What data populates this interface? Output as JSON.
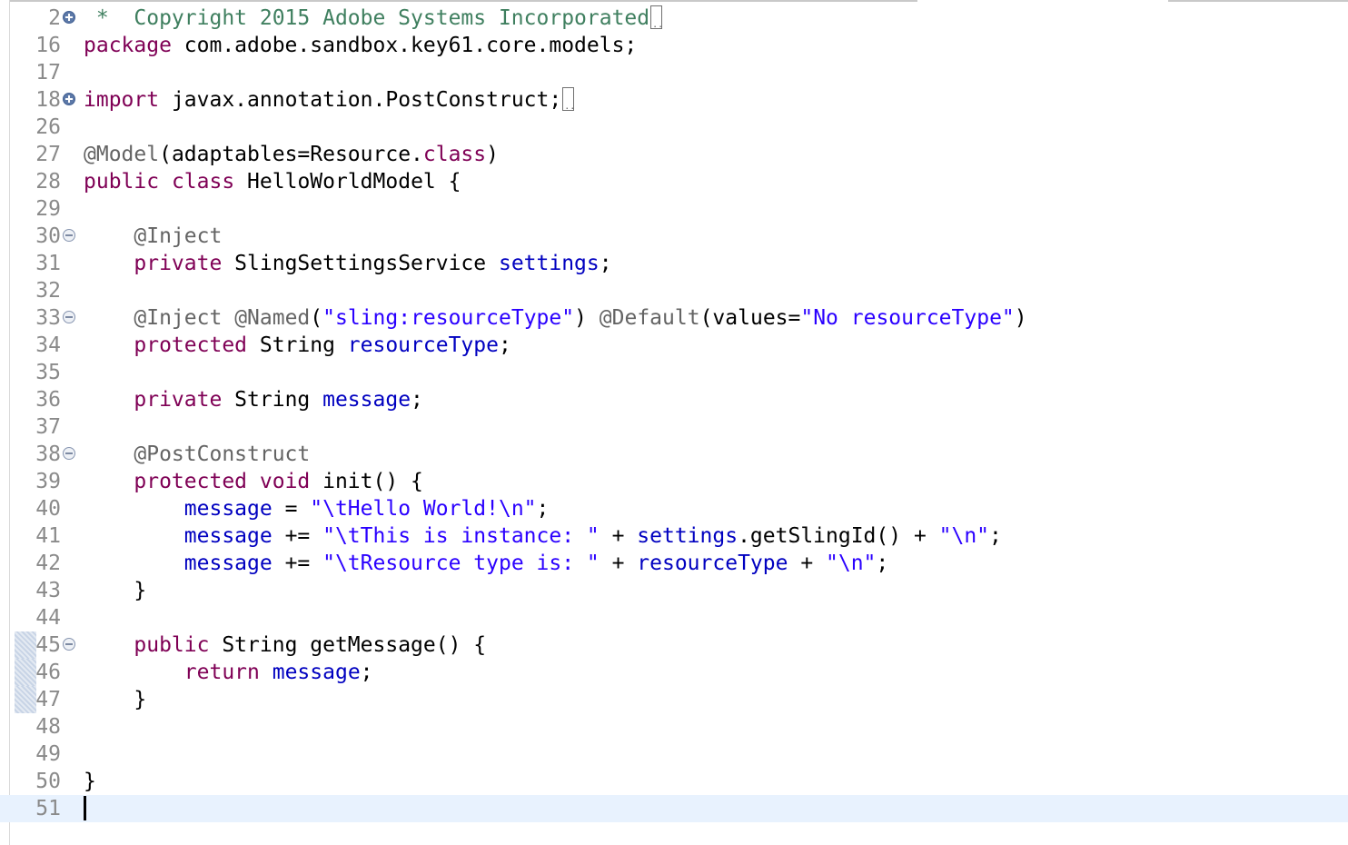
{
  "editor": {
    "lines": [
      {
        "n": "2",
        "fold": "plus",
        "tokens": [
          {
            "t": " *  ",
            "c": "cmt"
          },
          {
            "t": "Copyright 2015 Adobe Systems Incorporated",
            "c": "cmt"
          },
          {
            "t": "",
            "c": "ellipsis"
          }
        ]
      },
      {
        "n": "16",
        "tokens": [
          {
            "t": "package",
            "c": "kw"
          },
          {
            "t": " com.adobe.sandbox.key61.core.models;"
          }
        ]
      },
      {
        "n": "17",
        "tokens": []
      },
      {
        "n": "18",
        "fold": "plus",
        "tokens": [
          {
            "t": "import",
            "c": "kw"
          },
          {
            "t": " javax.annotation.PostConstruct;"
          },
          {
            "t": "",
            "c": "ellipsis"
          }
        ]
      },
      {
        "n": "26",
        "tokens": []
      },
      {
        "n": "27",
        "tokens": [
          {
            "t": "@Model",
            "c": "ann"
          },
          {
            "t": "(adaptables=Resource."
          },
          {
            "t": "class",
            "c": "kw"
          },
          {
            "t": ")"
          }
        ]
      },
      {
        "n": "28",
        "tokens": [
          {
            "t": "public",
            "c": "kw"
          },
          {
            "t": " "
          },
          {
            "t": "class",
            "c": "kw"
          },
          {
            "t": " HelloWorldModel {"
          }
        ]
      },
      {
        "n": "29",
        "tokens": []
      },
      {
        "n": "30",
        "fold": "minus",
        "tokens": [
          {
            "t": "    "
          },
          {
            "t": "@Inject",
            "c": "ann"
          }
        ]
      },
      {
        "n": "31",
        "tokens": [
          {
            "t": "    "
          },
          {
            "t": "private",
            "c": "kw"
          },
          {
            "t": " SlingSettingsService "
          },
          {
            "t": "settings",
            "c": "fld"
          },
          {
            "t": ";"
          }
        ]
      },
      {
        "n": "32",
        "tokens": []
      },
      {
        "n": "33",
        "fold": "minus",
        "tokens": [
          {
            "t": "    "
          },
          {
            "t": "@Inject",
            "c": "ann"
          },
          {
            "t": " "
          },
          {
            "t": "@Named",
            "c": "ann"
          },
          {
            "t": "("
          },
          {
            "t": "\"sling:resourceType\"",
            "c": "str"
          },
          {
            "t": ") "
          },
          {
            "t": "@Default",
            "c": "ann"
          },
          {
            "t": "(values="
          },
          {
            "t": "\"No resourceType\"",
            "c": "str"
          },
          {
            "t": ")"
          }
        ]
      },
      {
        "n": "34",
        "tokens": [
          {
            "t": "    "
          },
          {
            "t": "protected",
            "c": "kw"
          },
          {
            "t": " String "
          },
          {
            "t": "resourceType",
            "c": "fld"
          },
          {
            "t": ";"
          }
        ]
      },
      {
        "n": "35",
        "tokens": []
      },
      {
        "n": "36",
        "tokens": [
          {
            "t": "    "
          },
          {
            "t": "private",
            "c": "kw"
          },
          {
            "t": " String "
          },
          {
            "t": "message",
            "c": "fld"
          },
          {
            "t": ";"
          }
        ]
      },
      {
        "n": "37",
        "tokens": []
      },
      {
        "n": "38",
        "fold": "minus",
        "tokens": [
          {
            "t": "    "
          },
          {
            "t": "@PostConstruct",
            "c": "ann"
          }
        ]
      },
      {
        "n": "39",
        "tokens": [
          {
            "t": "    "
          },
          {
            "t": "protected",
            "c": "kw"
          },
          {
            "t": " "
          },
          {
            "t": "void",
            "c": "kw"
          },
          {
            "t": " init() {"
          }
        ]
      },
      {
        "n": "40",
        "tokens": [
          {
            "t": "        "
          },
          {
            "t": "message",
            "c": "fld"
          },
          {
            "t": " = "
          },
          {
            "t": "\"\\tHello World!\\n\"",
            "c": "str"
          },
          {
            "t": ";"
          }
        ]
      },
      {
        "n": "41",
        "tokens": [
          {
            "t": "        "
          },
          {
            "t": "message",
            "c": "fld"
          },
          {
            "t": " += "
          },
          {
            "t": "\"\\tThis is instance: \"",
            "c": "str"
          },
          {
            "t": " + "
          },
          {
            "t": "settings",
            "c": "fld"
          },
          {
            "t": ".getSlingId() + "
          },
          {
            "t": "\"\\n\"",
            "c": "str"
          },
          {
            "t": ";"
          }
        ]
      },
      {
        "n": "42",
        "tokens": [
          {
            "t": "        "
          },
          {
            "t": "message",
            "c": "fld"
          },
          {
            "t": " += "
          },
          {
            "t": "\"\\tResource type is: \"",
            "c": "str"
          },
          {
            "t": " + "
          },
          {
            "t": "resourceType",
            "c": "fld"
          },
          {
            "t": " + "
          },
          {
            "t": "\"\\n\"",
            "c": "str"
          },
          {
            "t": ";"
          }
        ]
      },
      {
        "n": "43",
        "tokens": [
          {
            "t": "    }"
          }
        ]
      },
      {
        "n": "44",
        "tokens": []
      },
      {
        "n": "45",
        "fold": "minus",
        "marked": true,
        "tokens": [
          {
            "t": "    "
          },
          {
            "t": "public",
            "c": "kw"
          },
          {
            "t": " String getMessage() {"
          }
        ]
      },
      {
        "n": "46",
        "marked": true,
        "tokens": [
          {
            "t": "        "
          },
          {
            "t": "return",
            "c": "kw"
          },
          {
            "t": " "
          },
          {
            "t": "message",
            "c": "fld"
          },
          {
            "t": ";"
          }
        ]
      },
      {
        "n": "47",
        "marked": true,
        "tokens": [
          {
            "t": "    }"
          }
        ]
      },
      {
        "n": "48",
        "tokens": []
      },
      {
        "n": "49",
        "tokens": []
      },
      {
        "n": "50",
        "tokens": [
          {
            "t": "}"
          }
        ]
      },
      {
        "n": "51",
        "current": true,
        "caret": true,
        "tokens": []
      }
    ]
  }
}
